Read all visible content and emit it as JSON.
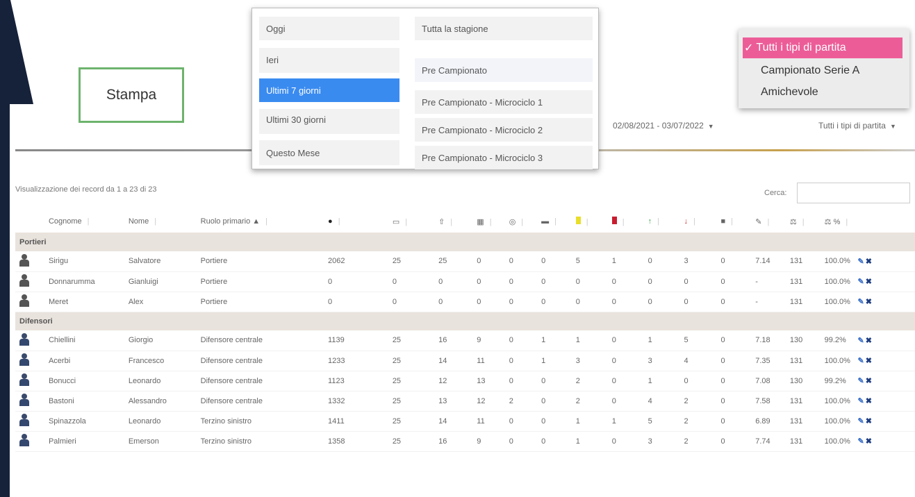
{
  "stampa_label": "Stampa",
  "date_range": "02/08/2021 - 03/07/2022",
  "match_type": "Tutti i tipi di partita",
  "date_menu": {
    "left": [
      "Oggi",
      "Ieri",
      "Ultimi 7 giorni",
      "Ultimi 30 giorni",
      "Questo Mese"
    ],
    "selected": "Ultimi 7 giorni",
    "right": [
      "Tutta la stagione",
      "Pre Campionato",
      "Pre Campionato - Microciclo 1",
      "Pre Campionato - Microciclo 2",
      "Pre Campionato - Microciclo 3"
    ]
  },
  "type_menu": {
    "check": "✓",
    "items": [
      "Tutti i tipi di partita",
      "Campionato Serie A",
      "Amichevole"
    ]
  },
  "records_info": "Visualizzazione dei record da 1 a 23 di 23",
  "search_label": "Cerca:",
  "columns": {
    "cognome": "Cognome",
    "nome": "Nome",
    "ruolo": "Ruolo primario",
    "pct": "%"
  },
  "groups": {
    "portieri": "Portieri",
    "difensori": "Difensori"
  },
  "players": [
    {
      "cognome": "Sirigu",
      "nome": "Salvatore",
      "ruolo": "Portiere",
      "min": "2062",
      "c1": "25",
      "c2": "25",
      "c3": "0",
      "c4": "0",
      "c5": "0",
      "yel": "5",
      "red": "1",
      "in": "0",
      "out": "3",
      "sub": "0",
      "avg": "7.14",
      "tot": "131",
      "pct": "100.0%"
    },
    {
      "cognome": "Donnarumma",
      "nome": "Gianluigi",
      "ruolo": "Portiere",
      "min": "0",
      "c1": "0",
      "c2": "0",
      "c3": "0",
      "c4": "0",
      "c5": "0",
      "yel": "0",
      "red": "0",
      "in": "0",
      "out": "0",
      "sub": "0",
      "avg": "-",
      "tot": "131",
      "pct": "100.0%"
    },
    {
      "cognome": "Meret",
      "nome": "Alex",
      "ruolo": "Portiere",
      "min": "0",
      "c1": "0",
      "c2": "0",
      "c3": "0",
      "c4": "0",
      "c5": "0",
      "yel": "0",
      "red": "0",
      "in": "0",
      "out": "0",
      "sub": "0",
      "avg": "-",
      "tot": "131",
      "pct": "100.0%"
    },
    {
      "cognome": "Chiellini",
      "nome": "Giorgio",
      "ruolo": "Difensore centrale",
      "min": "1139",
      "c1": "25",
      "c2": "16",
      "c3": "9",
      "c4": "0",
      "c5": "1",
      "yel": "1",
      "red": "0",
      "in": "1",
      "out": "5",
      "sub": "0",
      "avg": "7.18",
      "tot": "130",
      "pct": "99.2%"
    },
    {
      "cognome": "Acerbi",
      "nome": "Francesco",
      "ruolo": "Difensore centrale",
      "min": "1233",
      "c1": "25",
      "c2": "14",
      "c3": "11",
      "c4": "0",
      "c5": "1",
      "yel": "3",
      "red": "0",
      "in": "3",
      "out": "4",
      "sub": "0",
      "avg": "7.35",
      "tot": "131",
      "pct": "100.0%"
    },
    {
      "cognome": "Bonucci",
      "nome": "Leonardo",
      "ruolo": "Difensore centrale",
      "min": "1123",
      "c1": "25",
      "c2": "12",
      "c3": "13",
      "c4": "0",
      "c5": "0",
      "yel": "2",
      "red": "0",
      "in": "1",
      "out": "0",
      "sub": "0",
      "avg": "7.08",
      "tot": "130",
      "pct": "99.2%"
    },
    {
      "cognome": "Bastoni",
      "nome": "Alessandro",
      "ruolo": "Difensore centrale",
      "min": "1332",
      "c1": "25",
      "c2": "13",
      "c3": "12",
      "c4": "2",
      "c5": "0",
      "yel": "2",
      "red": "0",
      "in": "4",
      "out": "2",
      "sub": "0",
      "avg": "7.58",
      "tot": "131",
      "pct": "100.0%"
    },
    {
      "cognome": "Spinazzola",
      "nome": "Leonardo",
      "ruolo": "Terzino sinistro",
      "min": "1411",
      "c1": "25",
      "c2": "14",
      "c3": "11",
      "c4": "0",
      "c5": "0",
      "yel": "1",
      "red": "1",
      "in": "5",
      "out": "2",
      "sub": "0",
      "avg": "6.89",
      "tot": "131",
      "pct": "100.0%"
    },
    {
      "cognome": "Palmieri",
      "nome": "Emerson",
      "ruolo": "Terzino sinistro",
      "min": "1358",
      "c1": "25",
      "c2": "16",
      "c3": "9",
      "c4": "0",
      "c5": "0",
      "yel": "1",
      "red": "0",
      "in": "3",
      "out": "2",
      "sub": "0",
      "avg": "7.74",
      "tot": "131",
      "pct": "100.0%"
    }
  ]
}
